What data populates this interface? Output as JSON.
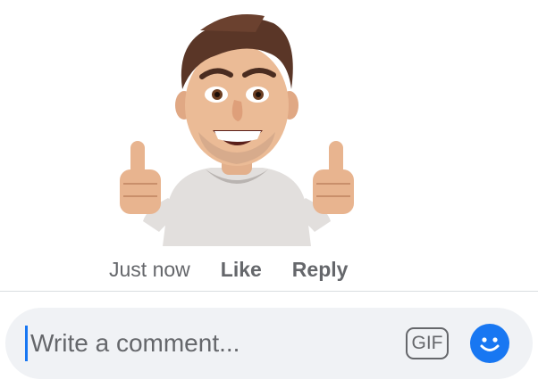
{
  "comment": {
    "sticker_icon": "thumbs-up-avatar-sticker",
    "time": "Just now",
    "like_label": "Like",
    "reply_label": "Reply"
  },
  "composer": {
    "placeholder": "Write a comment...",
    "gif_label": "GIF",
    "emoji_icon": "smiley-icon"
  },
  "colors": {
    "accent": "#1877f2",
    "muted_text": "#65676b",
    "input_bg": "#f0f2f5"
  }
}
